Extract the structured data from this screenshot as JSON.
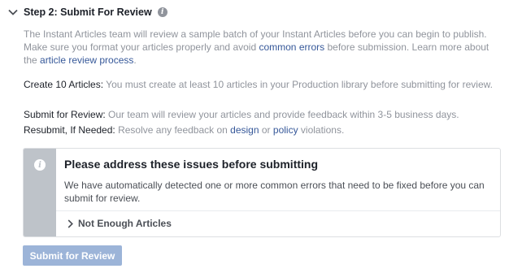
{
  "step": {
    "title": "Step 2: Submit For Review",
    "info_icon": "info-icon",
    "chevron_icon": "chevron-down-icon"
  },
  "intro": {
    "text_1": "The Instant Articles team will review a sample batch of your Instant Articles before you can begin to publish. Make sure you format your articles properly and avoid ",
    "link_common_errors": "common errors",
    "text_2": " before submission. Learn more about the ",
    "link_review_process": "article review process",
    "text_3": "."
  },
  "requirements": [
    {
      "term": "Create 10 Articles:",
      "description": "You must create at least 10 articles in your Production library before submitting for review."
    },
    {
      "term": "Submit for Review:",
      "description": "Our team will review your articles and provide feedback within 3-5 business days."
    },
    {
      "term": "Resubmit, If Needed:",
      "description_1": "Resolve any feedback on ",
      "link_design": "design",
      "description_2": " or ",
      "link_policy": "policy",
      "description_3": " violations."
    }
  ],
  "alert": {
    "icon": "info-icon",
    "title": "Please address these issues before submitting",
    "text": "We have automatically detected one or more common errors that need to be fixed before you can submit for review.",
    "issues": [
      {
        "label": "Not Enough Articles",
        "icon": "chevron-right-icon"
      }
    ]
  },
  "submit_button": {
    "label": "Submit for Review",
    "disabled": true
  },
  "colors": {
    "link": "#365899",
    "muted_text": "#90949c",
    "dark_text": "#1d2129",
    "rail": "#bec3c9",
    "button_disabled": "#9cb4d8"
  }
}
